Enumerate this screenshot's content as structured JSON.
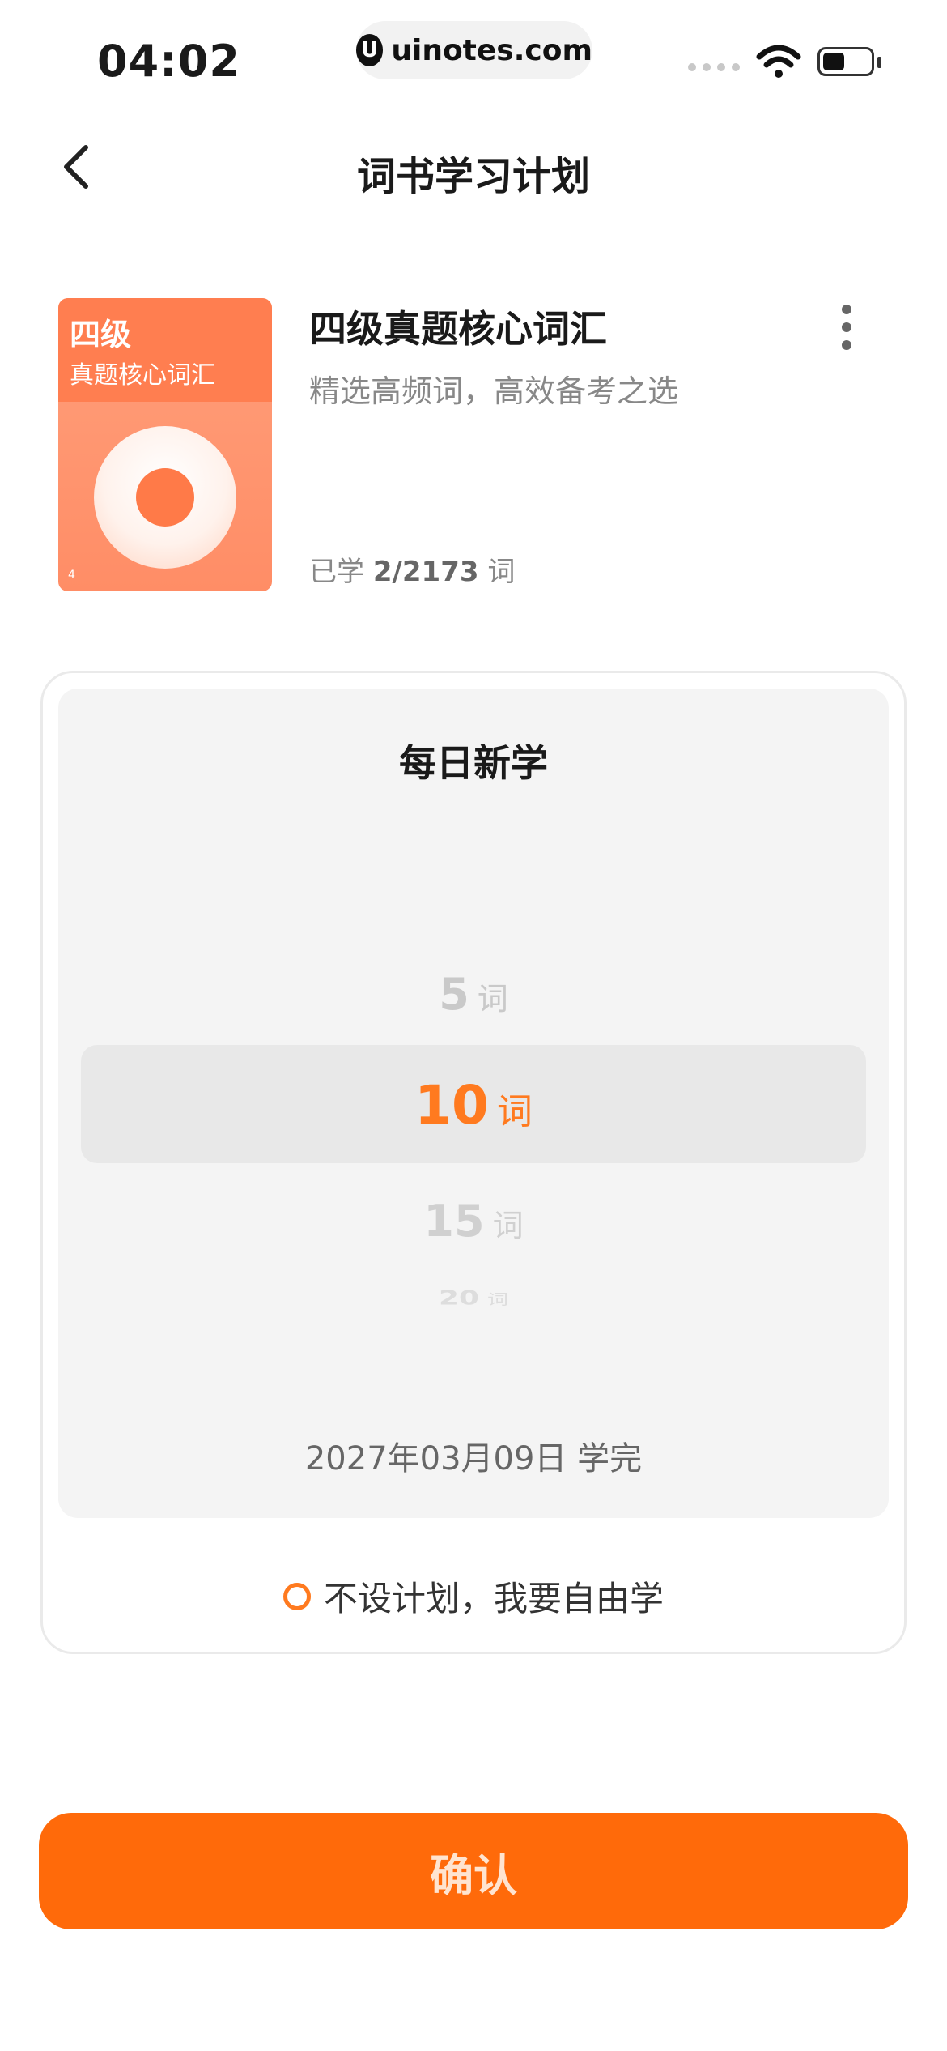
{
  "status_bar": {
    "time": "04:02",
    "site": "uinotes.com"
  },
  "header": {
    "title": "词书学习计划"
  },
  "book": {
    "cover_title": "四级",
    "cover_subtitle": "真题核心词汇",
    "cover_number": "4",
    "name": "四级真题核心词汇",
    "description": "精选高频词，高效备考之选",
    "progress_prefix": "已学",
    "progress_value": "2/2173",
    "progress_unit": "词"
  },
  "plan": {
    "title": "每日新学",
    "picker": [
      {
        "value": "5",
        "unit": "词"
      },
      {
        "value": "10",
        "unit": "词",
        "selected": true
      },
      {
        "value": "15",
        "unit": "词"
      },
      {
        "value": "20",
        "unit": "词"
      }
    ],
    "finish_date": "2027年03月09日 学完",
    "free_option": "不设计划，我要自由学"
  },
  "confirm_label": "确认",
  "colors": {
    "accent": "#ff7a1f",
    "button": "#ff6a0a",
    "cover": "#ff7e50"
  }
}
